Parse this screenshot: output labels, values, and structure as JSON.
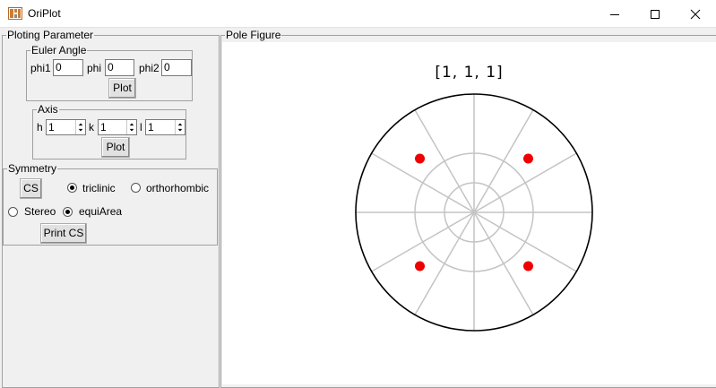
{
  "window": {
    "title": "OriPlot",
    "controls": [
      "minimize",
      "maximize",
      "close"
    ]
  },
  "ploting_parameter": {
    "legend": "Ploting Parameter",
    "euler_angle": {
      "legend": "Euler Angle",
      "phi1_label": "phi1",
      "phi1_value": "0",
      "phi_label": "phi",
      "phi_value": "0",
      "phi2_label": "phi2",
      "phi2_value": "0",
      "plot_button": "Plot"
    },
    "axis": {
      "legend": "Axis",
      "h_label": "h",
      "h_value": "1",
      "k_label": "k",
      "k_value": "1",
      "l_label": "l",
      "l_value": "1",
      "plot_button": "Plot"
    },
    "symmetry": {
      "legend": "Symmetry",
      "cs_button": "CS",
      "triclinic_label": "triclinic",
      "triclinic_checked": true,
      "orthorhombic_label": "orthorhombic",
      "orthorhombic_checked": false,
      "stereo_label": "Stereo",
      "stereo_checked": false,
      "equiarea_label": "equiArea",
      "equiarea_checked": true,
      "print_cs_button": "Print CS"
    }
  },
  "pole_figure": {
    "legend": "Pole Figure",
    "title": "[1, 1, 1]",
    "point_color": "#ee0000",
    "grid_color": "#c4c4c4",
    "rim_color": "#000000",
    "pole_count": 4
  },
  "colors": {
    "window_bg": "#f0f0f0",
    "plot_bg": "#ffffff"
  }
}
